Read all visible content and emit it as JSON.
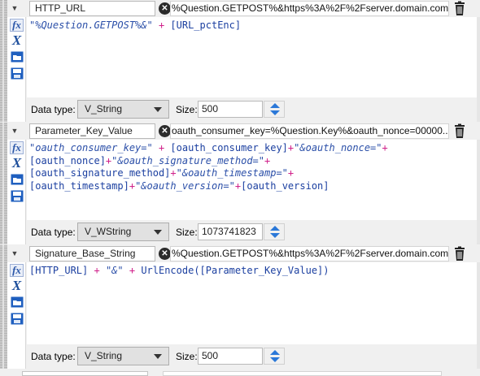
{
  "fields": [
    {
      "name": "HTTP_URL",
      "preview": "%Question.GETPOST%&https%3A%2F%2Fserver.domain.com...",
      "expression_lines": [
        [
          {
            "t": "str",
            "v": "\"%Question.GETPOST%&\""
          },
          {
            "t": "op",
            "v": " + "
          },
          {
            "t": "fld",
            "v": "[URL_pctEnc]"
          }
        ]
      ],
      "data_type_label": "Data type:",
      "data_type": "V_String",
      "size_label": "Size:",
      "size": "500"
    },
    {
      "name": "Parameter_Key_Value",
      "preview": "oauth_consumer_key=%Question.Key%&oauth_nonce=00000...",
      "expression_lines": [
        [
          {
            "t": "str",
            "v": "\"oauth_consumer_key=\""
          },
          {
            "t": "op",
            "v": " + "
          },
          {
            "t": "fld",
            "v": "[oauth_consumer_key]"
          },
          {
            "t": "op",
            "v": "+"
          },
          {
            "t": "str",
            "v": "\"&oauth_nonce=\""
          },
          {
            "t": "op",
            "v": "+"
          }
        ],
        [
          {
            "t": "fld",
            "v": "[oauth_nonce]"
          },
          {
            "t": "op",
            "v": "+"
          },
          {
            "t": "str",
            "v": "\"&oauth_signature_method=\""
          },
          {
            "t": "op",
            "v": "+"
          }
        ],
        [
          {
            "t": "fld",
            "v": "[oauth_signature_method]"
          },
          {
            "t": "op",
            "v": "+"
          },
          {
            "t": "str",
            "v": "\"&oauth_timestamp=\""
          },
          {
            "t": "op",
            "v": "+"
          }
        ],
        [
          {
            "t": "fld",
            "v": "[oauth_timestamp]"
          },
          {
            "t": "op",
            "v": "+"
          },
          {
            "t": "str",
            "v": "\"&oauth_version=\""
          },
          {
            "t": "op",
            "v": "+"
          },
          {
            "t": "fld",
            "v": "[oauth_version]"
          }
        ]
      ],
      "data_type_label": "Data type:",
      "data_type": "V_WString",
      "size_label": "Size:",
      "size": "1073741823"
    },
    {
      "name": "Signature_Base_String",
      "preview": "%Question.GETPOST%&https%3A%2F%2Fserver.domain.com...",
      "expression_lines": [
        [
          {
            "t": "fld",
            "v": "[HTTP_URL]"
          },
          {
            "t": "op",
            "v": " + "
          },
          {
            "t": "str",
            "v": "\"&\""
          },
          {
            "t": "op",
            "v": " + "
          },
          {
            "t": "fld",
            "v": "UrlEncode([Parameter_Key_Value])"
          }
        ]
      ],
      "data_type_label": "Data type:",
      "data_type": "V_String",
      "size_label": "Size:",
      "size": "500"
    }
  ],
  "icons": {
    "clear": "clear-icon",
    "trash": "trash-icon",
    "fx": "fx",
    "variable": "X",
    "open": "folder-open-icon",
    "save": "save-icon",
    "collapse": "caret-down-icon"
  },
  "colors": {
    "string_literal": "#2b4fa8",
    "operator": "#d0208a",
    "field": "#1b3fa0",
    "spin_arrow": "#2b78d8"
  }
}
